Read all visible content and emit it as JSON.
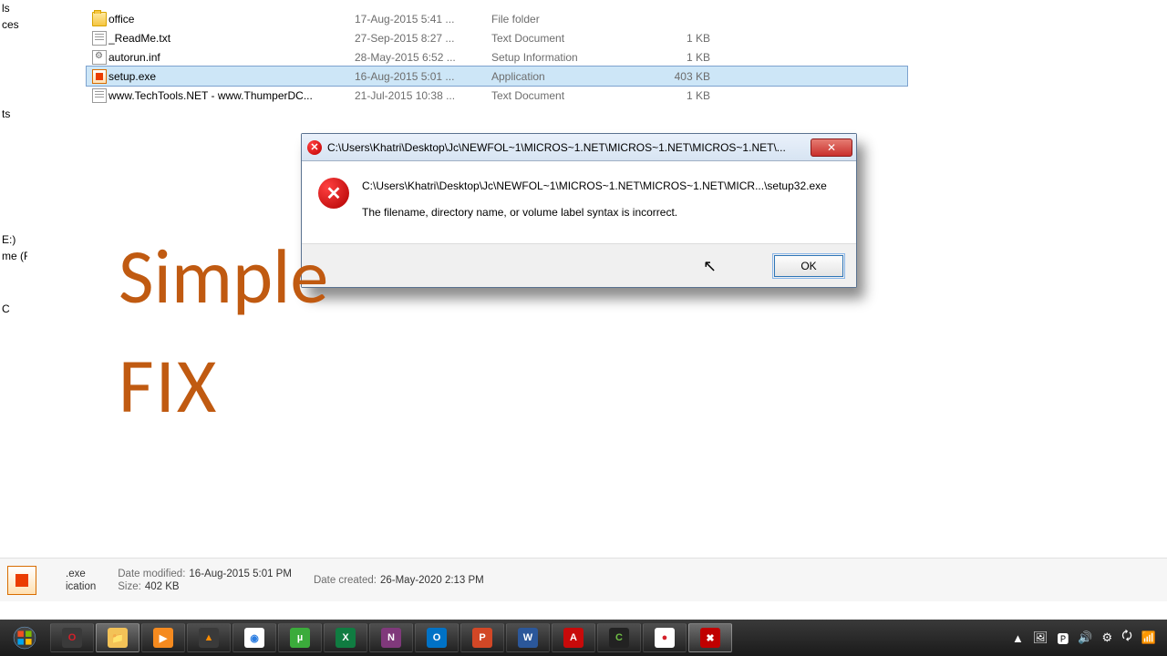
{
  "sidebar": {
    "frag1": "ls",
    "frag2": "ces",
    "frag3": "ts",
    "frag4": "",
    "frag5": "E:)",
    "frag6": "me (F:)",
    "frag7": "C"
  },
  "files": [
    {
      "icon": "folder",
      "name": "office",
      "date": "17-Aug-2015 5:41 ...",
      "type": "File folder",
      "size": ""
    },
    {
      "icon": "txt",
      "name": "_ReadMe.txt",
      "date": "27-Sep-2015 8:27 ...",
      "type": "Text Document",
      "size": "1 KB"
    },
    {
      "icon": "inf",
      "name": "autorun.inf",
      "date": "28-May-2015 6:52 ...",
      "type": "Setup Information",
      "size": "1 KB"
    },
    {
      "icon": "exe",
      "name": "setup.exe",
      "date": "16-Aug-2015 5:01 ...",
      "type": "Application",
      "size": "403 KB"
    },
    {
      "icon": "txt",
      "name": "www.TechTools.NET - www.ThumperDC...",
      "date": "21-Jul-2015 10:38 ...",
      "type": "Text Document",
      "size": "1 KB"
    }
  ],
  "dialog": {
    "title": "C:\\Users\\Khatri\\Desktop\\Jc\\NEWFOL~1\\MICROS~1.NET\\MICROS~1.NET\\MICROS~1.NET\\...",
    "path": "C:\\Users\\Khatri\\Desktop\\Jc\\NEWFOL~1\\MICROS~1.NET\\MICROS~1.NET\\MICR...\\setup32.exe",
    "message": "The filename, directory name, or volume label syntax is incorrect.",
    "close_glyph": "✕",
    "ok_label": "OK"
  },
  "overlay": {
    "line1": "Simple",
    "line2": "FIX"
  },
  "details": {
    "name": ".exe",
    "type": "ication",
    "modified_label": "Date modified:",
    "modified": "16-Aug-2015 5:01 PM",
    "created_label": "Date created:",
    "created": "26-May-2020 2:13 PM",
    "size_label": "Size:",
    "size": "402 KB"
  },
  "taskbar": {
    "items": [
      {
        "name": "opera",
        "bg": "#3a3a3a",
        "glyph": "O",
        "color": "#d4202a"
      },
      {
        "name": "file-explorer",
        "bg": "#f3c257",
        "glyph": "📁",
        "color": "#7a5100",
        "active": true
      },
      {
        "name": "media-player",
        "bg": "#f58a1f",
        "glyph": "▶",
        "color": "#fff"
      },
      {
        "name": "vlc",
        "bg": "#3a3a3a",
        "glyph": "▲",
        "color": "#ff8c00"
      },
      {
        "name": "chrome",
        "bg": "#ffffff",
        "glyph": "◉",
        "color": "#2b7de1"
      },
      {
        "name": "utorrent",
        "bg": "#3bab3b",
        "glyph": "µ",
        "color": "#fff"
      },
      {
        "name": "excel",
        "bg": "#107c41",
        "glyph": "X",
        "color": "#fff"
      },
      {
        "name": "onenote",
        "bg": "#80397b",
        "glyph": "N",
        "color": "#fff"
      },
      {
        "name": "outlook",
        "bg": "#0072c6",
        "glyph": "O",
        "color": "#fff"
      },
      {
        "name": "powerpoint",
        "bg": "#d24726",
        "glyph": "P",
        "color": "#fff"
      },
      {
        "name": "word",
        "bg": "#2b579a",
        "glyph": "W",
        "color": "#fff"
      },
      {
        "name": "adobe-reader",
        "bg": "#c80a0a",
        "glyph": "A",
        "color": "#fff"
      },
      {
        "name": "camtasia",
        "bg": "#222",
        "glyph": "C",
        "color": "#6fbf44"
      },
      {
        "name": "recorder",
        "bg": "#ffffff",
        "glyph": "●",
        "color": "#d4202a"
      },
      {
        "name": "error-dialog-task",
        "bg": "#3a3a3a",
        "glyph": "✖",
        "color": "#fff",
        "badge": "#c00000",
        "active": true
      }
    ],
    "tray": [
      "▲",
      "🖼",
      "🅿",
      "🔊",
      "⚙",
      "🗘",
      "📶"
    ]
  }
}
